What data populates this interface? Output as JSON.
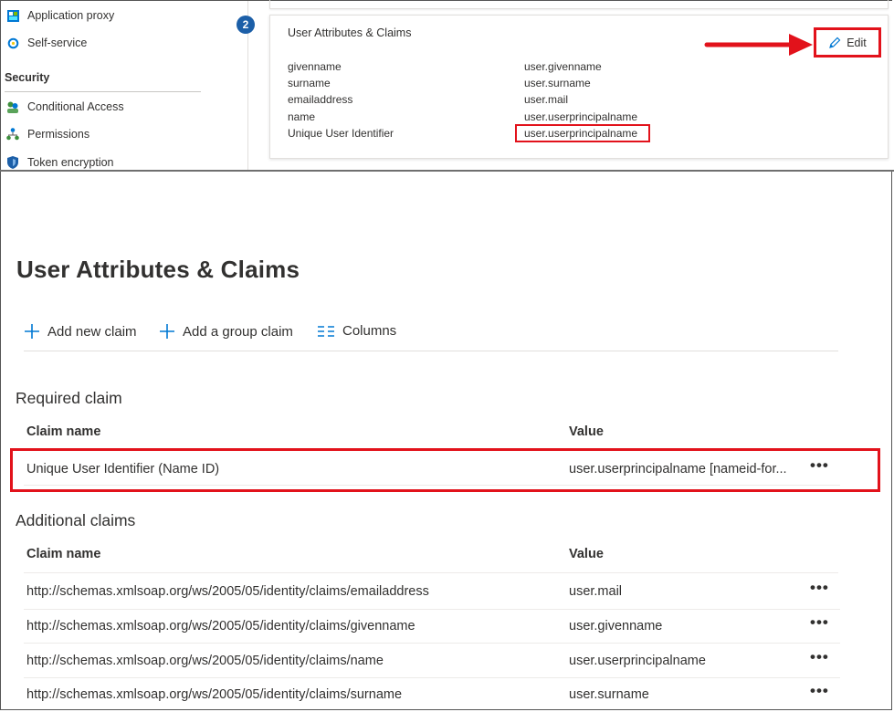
{
  "sidebar": {
    "items_top": [
      {
        "label": "Application proxy",
        "icon": "grid-icon"
      },
      {
        "label": "Self-service",
        "icon": "refresh-icon"
      }
    ],
    "section_title": "Security",
    "items_security": [
      {
        "label": "Conditional Access",
        "icon": "people-icon"
      },
      {
        "label": "Permissions",
        "icon": "org-icon"
      },
      {
        "label": "Token encryption",
        "icon": "shield-icon"
      }
    ]
  },
  "card": {
    "step": "2",
    "title": "User Attributes & Claims",
    "edit_label": "Edit",
    "attributes": [
      {
        "name": "givenname",
        "value": "user.givenname"
      },
      {
        "name": "surname",
        "value": "user.surname"
      },
      {
        "name": "emailaddress",
        "value": "user.mail"
      },
      {
        "name": "name",
        "value": "user.userprincipalname"
      },
      {
        "name": "Unique User Identifier",
        "value": "user.userprincipalname"
      }
    ]
  },
  "page": {
    "title": "User Attributes & Claims",
    "toolbar": {
      "add_claim": "Add new claim",
      "add_group_claim": "Add a group claim",
      "columns": "Columns"
    },
    "required": {
      "heading": "Required claim",
      "col_name": "Claim name",
      "col_value": "Value",
      "rows": [
        {
          "name": "Unique User Identifier (Name ID)",
          "value": "user.userprincipalname [nameid-for...",
          "more": "•••"
        }
      ]
    },
    "additional": {
      "heading": "Additional claims",
      "col_name": "Claim name",
      "col_value": "Value",
      "rows": [
        {
          "name": "http://schemas.xmlsoap.org/ws/2005/05/identity/claims/emailaddress",
          "value": "user.mail",
          "more": "•••"
        },
        {
          "name": "http://schemas.xmlsoap.org/ws/2005/05/identity/claims/givenname",
          "value": "user.givenname",
          "more": "•••"
        },
        {
          "name": "http://schemas.xmlsoap.org/ws/2005/05/identity/claims/name",
          "value": "user.userprincipalname",
          "more": "•••"
        },
        {
          "name": "http://schemas.xmlsoap.org/ws/2005/05/identity/claims/surname",
          "value": "user.surname",
          "more": "•••"
        }
      ]
    }
  },
  "colors": {
    "accent": "#0078d4",
    "highlight_red": "#e2121b",
    "badge_blue": "#1c5fa8"
  }
}
